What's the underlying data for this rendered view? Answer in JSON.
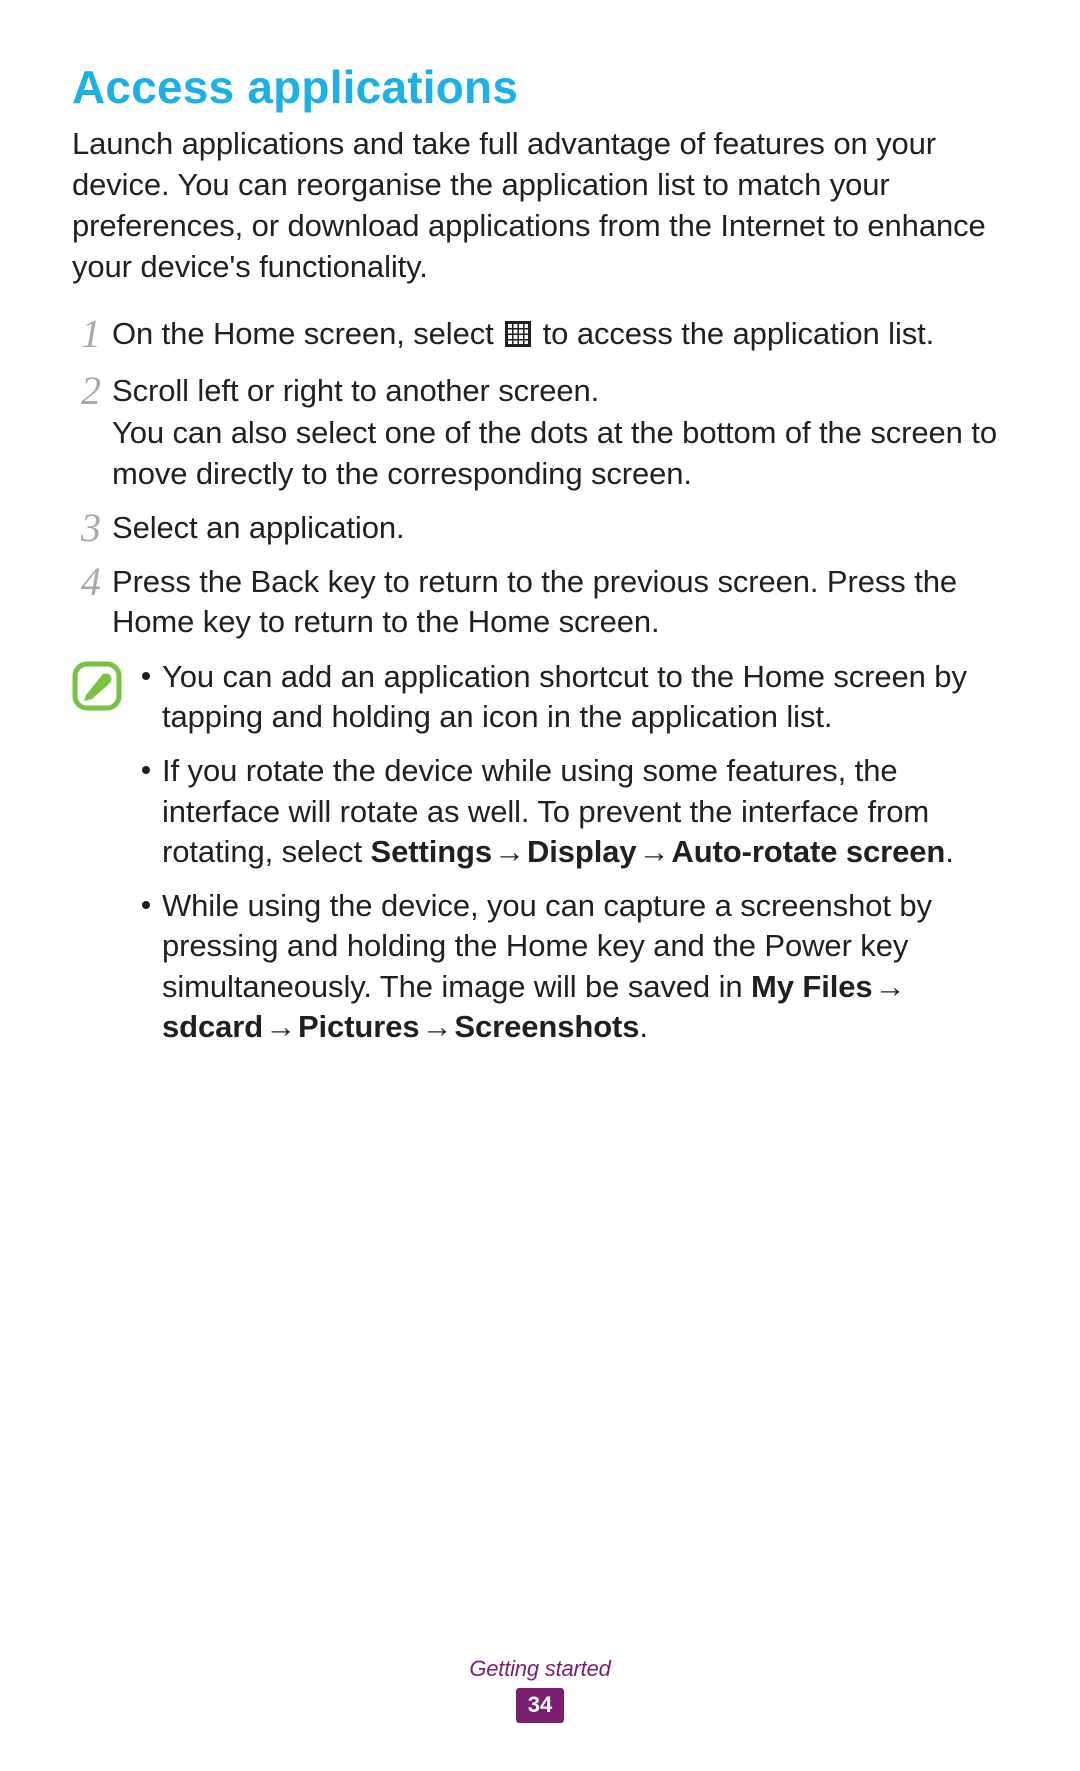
{
  "title": "Access applications",
  "intro": "Launch applications and take full advantage of features on your device. You can reorganise the application list to match your preferences, or download applications from the Internet to enhance your device's functionality.",
  "steps": [
    {
      "num": "1",
      "text_before": "On the Home screen, select ",
      "icon": "apps-grid-icon",
      "text_after": " to access the application list.",
      "sub": ""
    },
    {
      "num": "2",
      "text_before": "Scroll left or right to another screen.",
      "icon": "",
      "text_after": "",
      "sub": "You can also select one of the dots at the bottom of the screen to move directly to the corresponding screen."
    },
    {
      "num": "3",
      "text_before": "Select an application.",
      "icon": "",
      "text_after": "",
      "sub": ""
    },
    {
      "num": "4",
      "text_before": "Press the Back key to return to the previous screen. Press the Home key to return to the Home screen.",
      "icon": "",
      "text_after": "",
      "sub": ""
    }
  ],
  "notes": {
    "icon": "pencil-note-icon",
    "items": [
      {
        "segments": [
          {
            "t": "You can add an application shortcut to the Home screen by tapping and holding an icon in the application list.",
            "b": false
          }
        ]
      },
      {
        "segments": [
          {
            "t": "If you rotate the device while using some features, the interface will rotate as well. To prevent the interface from rotating, select ",
            "b": false
          },
          {
            "t": "Settings",
            "b": true
          },
          {
            "t": " → ",
            "b": true,
            "arrow": true
          },
          {
            "t": "Display",
            "b": true
          },
          {
            "t": " → ",
            "b": true,
            "arrow": true
          },
          {
            "t": "Auto-rotate screen",
            "b": true
          },
          {
            "t": ".",
            "b": false
          }
        ]
      },
      {
        "segments": [
          {
            "t": "While using the device, you can capture a screenshot by pressing and holding the Home key and the Power key simultaneously. The image will be saved in ",
            "b": false
          },
          {
            "t": "My Files",
            "b": true
          },
          {
            "t": " → ",
            "b": true,
            "arrow": true
          },
          {
            "t": "sdcard",
            "b": true
          },
          {
            "t": " → ",
            "b": true,
            "arrow": true
          },
          {
            "t": "Pictures",
            "b": true
          },
          {
            "t": " → ",
            "b": true,
            "arrow": true
          },
          {
            "t": "Screenshots",
            "b": true
          },
          {
            "t": ".",
            "b": false
          }
        ]
      }
    ]
  },
  "footer": {
    "section": "Getting started",
    "page_number": "34"
  }
}
